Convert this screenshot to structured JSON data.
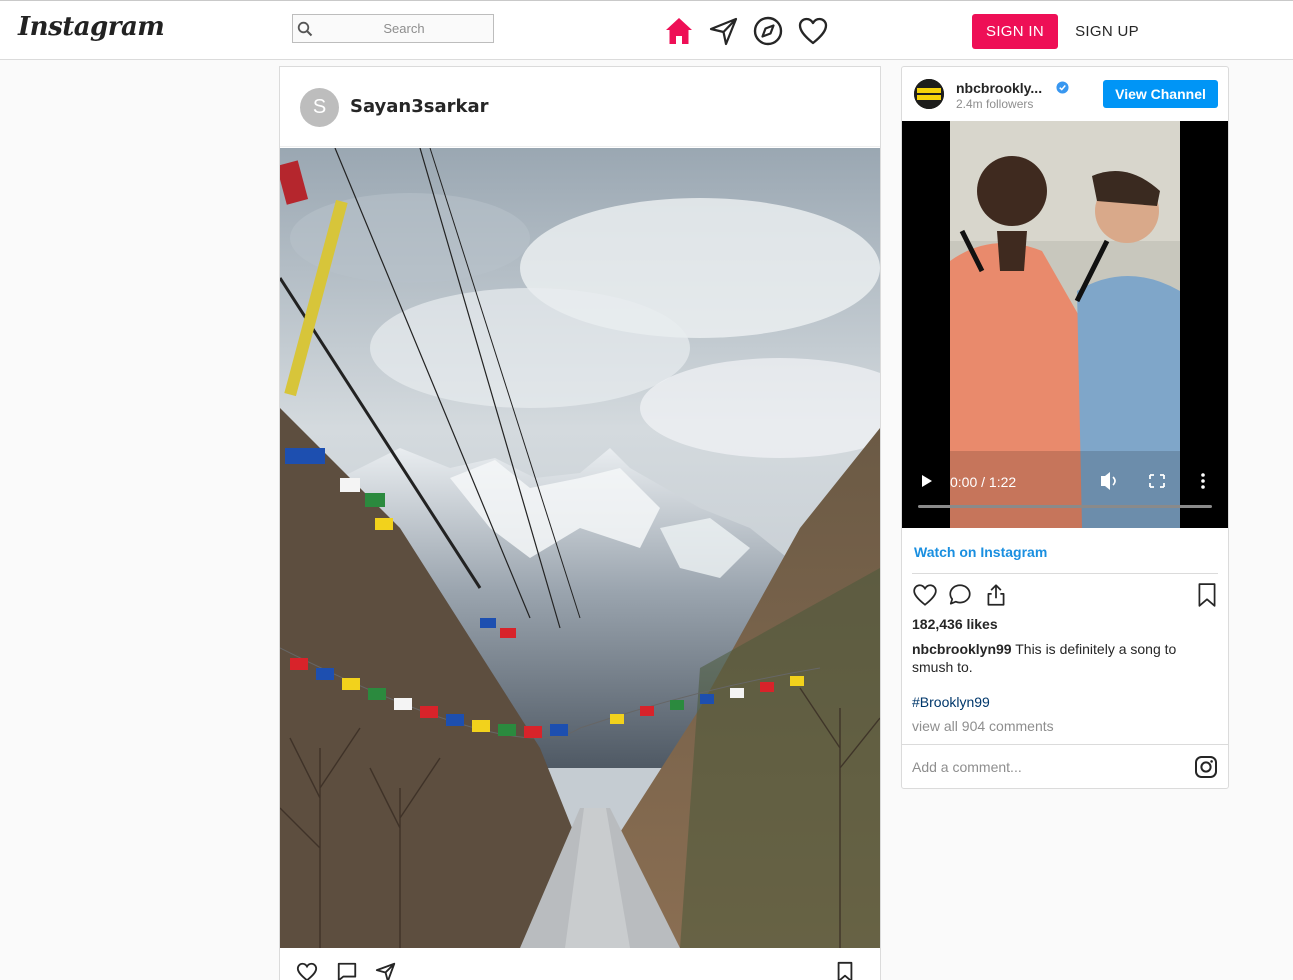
{
  "header": {
    "logo_text": "Instagram",
    "search": {
      "placeholder": "Search",
      "value": ""
    },
    "nav_icons": [
      "home-icon",
      "direct-message-icon",
      "explore-icon",
      "activity-heart-icon"
    ],
    "sign_in_label": "SIGN IN",
    "sign_up_label": "SIGN UP",
    "accent_color": "#ee0f56"
  },
  "post": {
    "avatar_initial": "S",
    "username": "Sayan3sarkar",
    "image_alt": "Mountain road with prayer flags",
    "actions": [
      "like-icon",
      "comment-icon",
      "share-icon",
      "save-icon"
    ]
  },
  "embed": {
    "username": "nbcbrookly...",
    "verified": true,
    "followers": "2.4m followers",
    "view_channel_label": "View Channel",
    "video": {
      "time": "0:00 / 1:22"
    },
    "watch_label": "Watch on Instagram",
    "likes": "182,436 likes",
    "caption_user": "nbcbrooklyn99",
    "caption_text": "This is definitely a song to smush to.",
    "hashtag": "#Brooklyn99",
    "view_comments": "view all 904 comments",
    "comment_placeholder": "Add a comment...",
    "link_color": "#1a8fe0",
    "button_color": "#0095f6"
  }
}
